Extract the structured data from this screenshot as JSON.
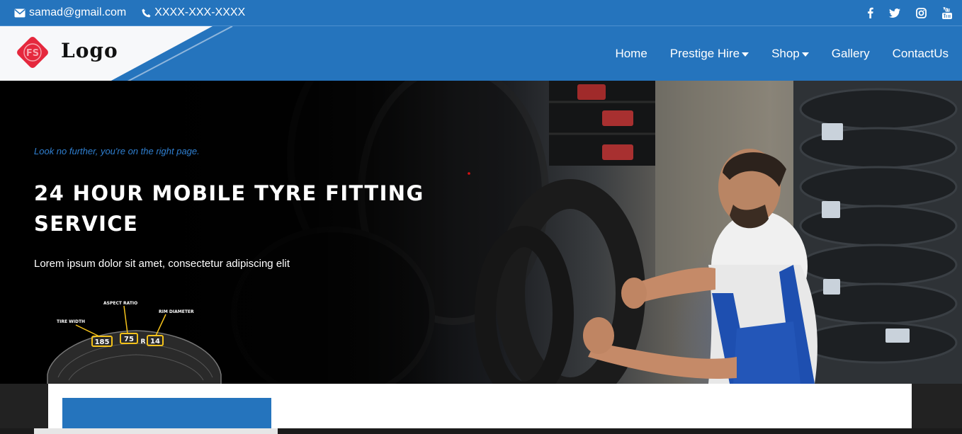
{
  "topbar": {
    "email": "samad@gmail.com",
    "phone": "XXXX-XXX-XXXX",
    "email_icon": "envelope-icon",
    "phone_icon": "phone-icon",
    "social": [
      "facebook-icon",
      "twitter-icon",
      "instagram-icon",
      "youtube-icon"
    ]
  },
  "brand": {
    "logo_text": "Logo",
    "mark_text": "FS",
    "mark_color": "#e5283d"
  },
  "nav": {
    "items": [
      {
        "label": "Home",
        "dropdown": false
      },
      {
        "label": "Prestige Hire",
        "dropdown": true
      },
      {
        "label": "Shop",
        "dropdown": true
      },
      {
        "label": "Gallery",
        "dropdown": false
      },
      {
        "label": "ContactUs",
        "dropdown": false
      }
    ]
  },
  "hero": {
    "tagline": "Look no further, you're on the right page.",
    "headline": "24 HOUR MOBILE TYRE FITTING SERVICE",
    "subtitle": "Lorem ipsum dolor sit amet, consectetur adipiscing elit",
    "diagram": {
      "tire_width": "TIRE WIDTH",
      "aspect_ratio": "ASPECT RATIO",
      "rim_diameter": "RIM DIAMETER",
      "width_value": "185",
      "ratio_value": "75",
      "rim_letter": "R",
      "rim_value": "14"
    }
  },
  "colors": {
    "primary": "#2574bd",
    "accent_text": "#2f7fd0"
  }
}
